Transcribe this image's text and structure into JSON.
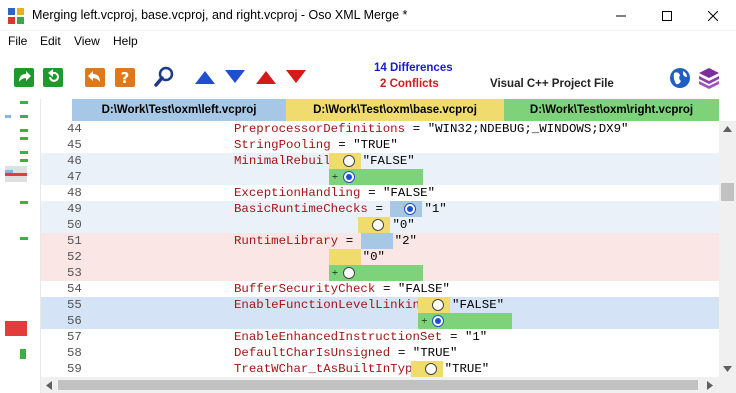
{
  "window": {
    "title": "Merging left.vcproj, base.vcproj, and right.vcproj - Oso XML Merge *"
  },
  "menu": [
    "File",
    "Edit",
    "View",
    "Help"
  ],
  "toolbar": {
    "buttons": [
      {
        "name": "take-left-right-icon",
        "color": "#1e9a2c"
      },
      {
        "name": "take-left-all-icon",
        "color": "#1e9a2c"
      },
      {
        "name": "take-right-icon",
        "color": "#e07818"
      },
      {
        "name": "help-conflict-icon",
        "color": "#e07818"
      },
      {
        "name": "magnifier-icon",
        "color": "#1b3a8c"
      },
      {
        "name": "previous-difference-icon",
        "color": "#1f4fd0"
      },
      {
        "name": "next-difference-icon",
        "color": "#1f4fd0"
      },
      {
        "name": "previous-conflict-icon",
        "color": "#d41a1a"
      },
      {
        "name": "next-conflict-icon",
        "color": "#d41a1a"
      }
    ],
    "differences_label": "14  Differences",
    "conflicts_label": "2  Conflicts",
    "file_type": "Visual C++ Project File",
    "right_icons": [
      "globe-icon",
      "stack-icon"
    ]
  },
  "columns": [
    {
      "label": "D:\\Work\\Test\\oxm\\left.vcproj",
      "color": "#a6c8e6"
    },
    {
      "label": "D:\\Work\\Test\\oxm\\base.vcproj",
      "color": "#f0dc6e"
    },
    {
      "label": "D:\\Work\\Test\\oxm\\right.vcproj",
      "color": "#7dd27a"
    }
  ],
  "colors": {
    "left": "#a6c8e6",
    "base": "#f0dc6e",
    "right": "#7dd27a",
    "conflict_bg": "#fbe6e6",
    "diff_bg": "#eaf1f9",
    "selected_bg": "#d4e3f5",
    "keyword": "#a31515"
  },
  "lines": [
    {
      "n": "44",
      "key": "PreprocessorDefinitions",
      "eq": " = ",
      "val": "\"WIN32;NDEBUG;_WINDOWS;DX9\"",
      "bg": ""
    },
    {
      "n": "45",
      "key": "StringPooling",
      "eq": " = ",
      "val": "\"TRUE\"",
      "bg": ""
    },
    {
      "n": "46",
      "key": "MinimalRebuild",
      "eq": " = ",
      "val": "",
      "bg": "diff",
      "cells": [
        {
          "c": "base",
          "radio": "off",
          "text": "\"FALSE\""
        }
      ]
    },
    {
      "n": "47",
      "key": "",
      "eq": "",
      "val": "",
      "bg": "diff",
      "cells": [
        {
          "c": "right",
          "radio": "sel",
          "text": "",
          "combine": "÷"
        }
      ]
    },
    {
      "n": "48",
      "key": "ExceptionHandling",
      "eq": " = ",
      "val": "\"FALSE\"",
      "bg": ""
    },
    {
      "n": "49",
      "key": "BasicRuntimeChecks",
      "eq": " = ",
      "val": "",
      "bg": "diff",
      "cells": [
        {
          "c": "left",
          "radio": "sel",
          "text": "\"1\""
        }
      ]
    },
    {
      "n": "50",
      "key": "",
      "eq": "",
      "val": "",
      "bg": "diff",
      "cells": [
        {
          "c": "base",
          "radio": "off",
          "text": "\"0\""
        }
      ]
    },
    {
      "n": "51",
      "key": "RuntimeLibrary",
      "eq": " = ",
      "val": "",
      "bg": "conflict",
      "cells": [
        {
          "c": "left",
          "radio": "none",
          "text": "\"2\""
        }
      ]
    },
    {
      "n": "52",
      "key": "",
      "eq": "",
      "val": "",
      "bg": "conflict",
      "cells": [
        {
          "c": "base",
          "radio": "none",
          "text": "\"0\""
        }
      ]
    },
    {
      "n": "53",
      "key": "",
      "eq": "",
      "val": "",
      "bg": "conflict",
      "cells": [
        {
          "c": "right",
          "radio": "off",
          "text": "",
          "combine": "÷"
        }
      ]
    },
    {
      "n": "54",
      "key": "BufferSecurityCheck",
      "eq": " = ",
      "val": "\"FALSE\"",
      "bg": ""
    },
    {
      "n": "55",
      "key": "EnableFunctionLevelLinking",
      "eq": " = ",
      "val": "",
      "bg": "selected",
      "cells": [
        {
          "c": "base",
          "radio": "off",
          "text": "\"FALSE\""
        }
      ]
    },
    {
      "n": "56",
      "key": "",
      "eq": "",
      "val": "",
      "bg": "selected",
      "cells": [
        {
          "c": "right",
          "radio": "sel",
          "text": "",
          "combine": "÷"
        }
      ]
    },
    {
      "n": "57",
      "key": "EnableEnhancedInstructionSet",
      "eq": " = ",
      "val": "\"1\"",
      "bg": ""
    },
    {
      "n": "58",
      "key": "DefaultCharIsUnsigned",
      "eq": " = ",
      "val": "\"TRUE\"",
      "bg": ""
    },
    {
      "n": "59",
      "key": "TreatWChar_tAsBuiltInType",
      "eq": " = ",
      "val": "",
      "bg": "",
      "cells": [
        {
          "c": "base",
          "radio": "off",
          "text": "\"TRUE\""
        }
      ]
    }
  ]
}
